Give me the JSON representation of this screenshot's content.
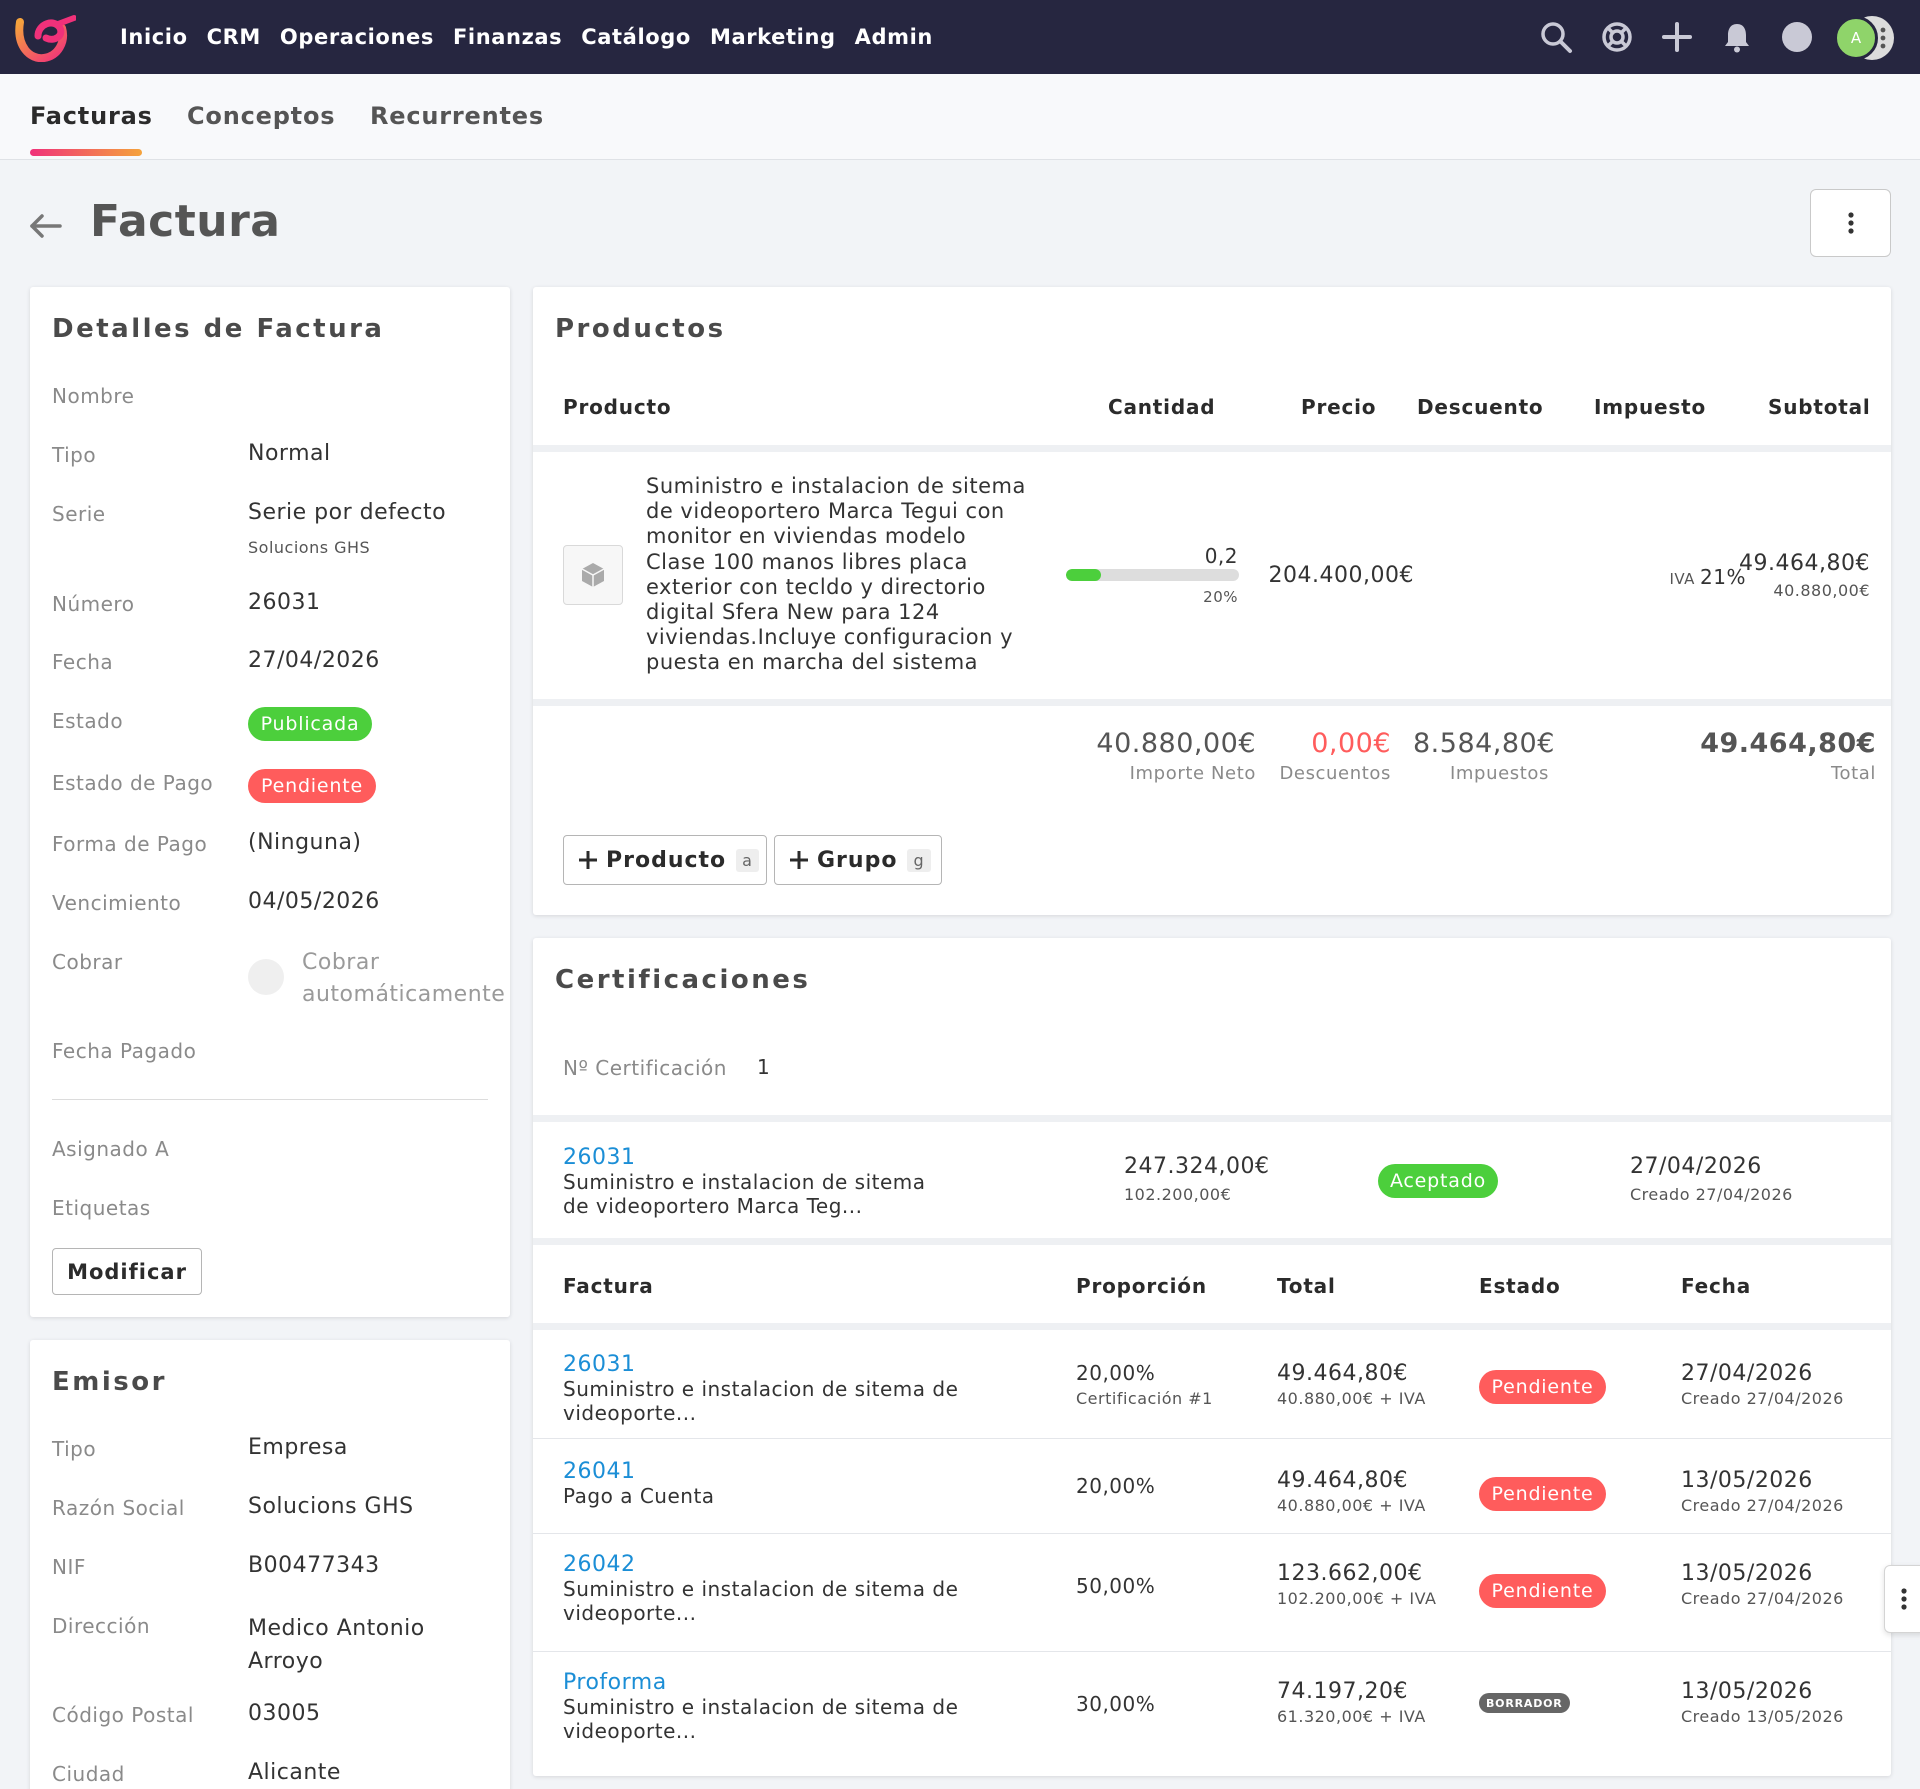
{
  "topnav": {
    "items": [
      "Inicio",
      "CRM",
      "Operaciones",
      "Finanzas",
      "Catálogo",
      "Marketing",
      "Admin"
    ],
    "avatar_initial": "A"
  },
  "subnav": {
    "tabs": [
      "Facturas",
      "Conceptos",
      "Recurrentes"
    ]
  },
  "page": {
    "title": "Factura"
  },
  "detalles": {
    "title": "Detalles de Factura",
    "nombre_label": "Nombre",
    "tipo_label": "Tipo",
    "tipo": "Normal",
    "serie_label": "Serie",
    "serie": "Serie por defecto",
    "serie_sub": "Solucions GHS",
    "numero_label": "Número",
    "numero": "26031",
    "fecha_label": "Fecha",
    "fecha": "27/04/2026",
    "estado_label": "Estado",
    "estado": "Publicada",
    "estado_pago_label": "Estado de Pago",
    "estado_pago": "Pendiente",
    "forma_pago_label": "Forma de Pago",
    "forma_pago": "(Ninguna)",
    "vencimiento_label": "Vencimiento",
    "vencimiento": "04/05/2026",
    "cobrar_label": "Cobrar",
    "cobrar_line1": "Cobrar",
    "cobrar_line2": "automáticamente",
    "fecha_pagado_label": "Fecha Pagado",
    "asignado_label": "Asignado A",
    "etiquetas_label": "Etiquetas",
    "modificar": "Modificar"
  },
  "emisor": {
    "title": "Emisor",
    "tipo_label": "Tipo",
    "tipo": "Empresa",
    "razon_label": "Razón Social",
    "razon": "Solucions GHS",
    "nif_label": "NIF",
    "nif": "B00477343",
    "direccion_label": "Dirección",
    "direccion_line1": "Medico Antonio",
    "direccion_line2": "Arroyo",
    "cp_label": "Código Postal",
    "cp": "03005",
    "ciudad_label": "Ciudad",
    "ciudad": "Alicante"
  },
  "productos": {
    "title": "Productos",
    "headers": {
      "producto": "Producto",
      "cantidad": "Cantidad",
      "precio": "Precio",
      "descuento": "Descuento",
      "impuesto": "Impuesto",
      "subtotal": "Subtotal"
    },
    "item": {
      "description_lines": [
        "Suministro e instalacion de sitema",
        "de videoportero Marca Tegui con",
        "monitor en viviendas modelo",
        "Clase 100 manos libres placa",
        "exterior con tecldo y directorio",
        "digital Sfera New para 124",
        "viviendas.Incluye configuracion y",
        "puesta en marcha del sistema"
      ],
      "cantidad": "0,2",
      "progress_fraction": 0.2,
      "progress_label": "20%",
      "precio": "204.400,00€",
      "impuesto_prefix": "IVA",
      "impuesto": "21%",
      "subtotal": "49.464,80€",
      "subtotal_net": "40.880,00€"
    },
    "totals": {
      "neto": "40.880,00€",
      "neto_label": "Importe Neto",
      "descuentos": "0,00€",
      "descuentos_label": "Descuentos",
      "impuestos": "8.584,80€",
      "impuestos_label": "Impuestos",
      "total": "49.464,80€",
      "total_label": "Total"
    },
    "add_producto": "Producto",
    "add_producto_key": "a",
    "add_grupo": "Grupo",
    "add_grupo_key": "g"
  },
  "certificaciones": {
    "title": "Certificaciones",
    "num_label": "Nº Certificación",
    "num": "1",
    "cert": {
      "id": "26031",
      "desc_line1": "Suministro e instalacion de sitema",
      "desc_line2": "de videoportero Marca Teg...",
      "total": "247.324,00€",
      "neto": "102.200,00€",
      "estado": "Aceptado",
      "fecha": "27/04/2026",
      "creado": "Creado 27/04/2026"
    },
    "headers": {
      "factura": "Factura",
      "proporcion": "Proporción",
      "total": "Total",
      "estado": "Estado",
      "fecha": "Fecha"
    },
    "rows": [
      {
        "id": "26031",
        "desc_line1": "Suministro e instalacion de sitema de",
        "desc_line2": "videoporte...",
        "proporcion": "20,00%",
        "proporcion_sub": "Certificación #1",
        "total": "49.464,80€",
        "total_sub": "40.880,00€ + IVA",
        "estado": "Pendiente",
        "fecha": "27/04/2026",
        "creado": "Creado 27/04/2026"
      },
      {
        "id": "26041",
        "desc_line1": "Pago a Cuenta",
        "desc_line2": "",
        "proporcion": "20,00%",
        "proporcion_sub": "",
        "total": "49.464,80€",
        "total_sub": "40.880,00€ + IVA",
        "estado": "Pendiente",
        "fecha": "13/05/2026",
        "creado": "Creado 27/04/2026"
      },
      {
        "id": "26042",
        "desc_line1": "Suministro e instalacion de sitema de",
        "desc_line2": "videoporte...",
        "proporcion": "50,00%",
        "proporcion_sub": "",
        "total": "123.662,00€",
        "total_sub": "102.200,00€ + IVA",
        "estado": "Pendiente",
        "fecha": "13/05/2026",
        "creado": "Creado 27/04/2026"
      },
      {
        "id": "Proforma",
        "desc_line1": "Suministro e instalacion de sitema de",
        "desc_line2": "videoporte...",
        "proporcion": "30,00%",
        "proporcion_sub": "",
        "total": "74.197,20€",
        "total_sub": "61.320,00€ + IVA",
        "estado": "BORRADOR",
        "fecha": "13/05/2026",
        "creado": "Creado 13/05/2026"
      }
    ]
  },
  "colors": {
    "nav_bg": "#262640",
    "green": "#4ccf3c",
    "red": "#ff5c5c",
    "link": "#1b8ed6",
    "draft": "#666666"
  }
}
